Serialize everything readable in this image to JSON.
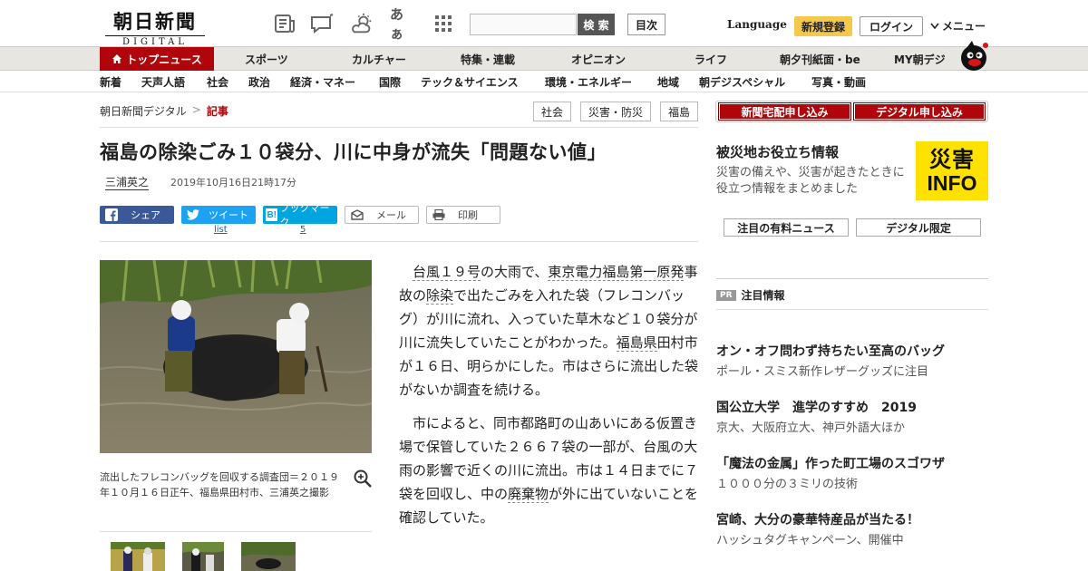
{
  "header": {
    "logo_main": "朝日新聞",
    "logo_sub": "DIGITAL",
    "search_placeholder": "",
    "search_label": "検 索",
    "toc_label": "目次",
    "font_label": "あぁ",
    "language_label": "Language",
    "register_label": "新規登録",
    "login_label": "ログイン",
    "menu_label": "メニュー"
  },
  "nav_primary": {
    "top_news": "トップニュース",
    "items": [
      "スポーツ",
      "カルチャー",
      "特集・連載",
      "オピニオン",
      "ライフ",
      "朝夕刊紙面・be",
      "MY朝デジ"
    ]
  },
  "nav_secondary": {
    "items": [
      "新着",
      "天声人語",
      "社会",
      "政治",
      "経済・マネー",
      "国際",
      "テック＆サイエンス",
      "環境・エネルギー",
      "地域",
      "朝デジスペシャル",
      "写真・動画"
    ]
  },
  "breadcrumb": {
    "home": "朝日新聞デジタル",
    "sep": ">",
    "current": "記事"
  },
  "tags": [
    "社会",
    "災害・防災",
    "福島"
  ],
  "article": {
    "headline": "福島の除染ごみ１０袋分、川に中身が流失「問題ない値」",
    "author": "三浦英之",
    "date": "2019年10月16日21時17分",
    "caption": "流出したフレコンバッグを回収する調査団＝２０１９年１０月１６日正午、福島県田村市、三浦英之撮影",
    "p1": [
      {
        "t": "台風１９号",
        "link": true
      },
      {
        "t": "の大雨で、",
        "link": false
      },
      {
        "t": "東京電力福島第一原発",
        "link": true
      },
      {
        "t": "事故の",
        "link": false
      },
      {
        "t": "除染",
        "link": true
      },
      {
        "t": "で出たごみを入れた袋（フレコンバッグ）が川に流れ、入っていた草木など１０袋分が川に流失していたことがわかった。",
        "link": false
      },
      {
        "t": "福島県",
        "link": true
      },
      {
        "t": "田村市が１６日、明らかにした。市はさらに流出した袋がないか調査を続ける。",
        "link": false
      }
    ],
    "p2": [
      {
        "t": "市によると、同市都路町の山あいにある仮置き場で保管していた２６６７袋の一部が、台風の大雨の影響で近くの川に流出。市は１４日までに７袋を回収し、中の",
        "link": false
      },
      {
        "t": "廃棄物",
        "link": true
      },
      {
        "t": "が外に出ていないことを確認していた。",
        "link": false
      }
    ]
  },
  "share": {
    "facebook": "シェア",
    "twitter": "ツイート",
    "twitter_sub": "list",
    "hatena": "ブックマーク",
    "hatena_sub": "5",
    "mail": "メール",
    "print": "印刷"
  },
  "sidebar": {
    "btn_delivery": "新聞宅配申し込み",
    "btn_digital": "デジタル申し込み",
    "disaster_title": "被災地お役立ち情報",
    "disaster_desc": "災害の備えや、災害が起きたときに役立つ情報をまとめました",
    "disaster_logo_top": "災害",
    "disaster_logo_bottom": "INFO",
    "pill_paid": "注目の有料ニュース",
    "pill_digital": "デジタル限定",
    "pr_badge": "PR",
    "pr_title": "注目情報",
    "ads": [
      {
        "title": "オン・オフ問わず持ちたい至高のバッグ",
        "sub": "ポール・スミス新作レザーグッズに注目"
      },
      {
        "title": "国公立大学　進学のすすめ　2019",
        "sub": "京大、大阪府立大、神戸外語大ほか"
      },
      {
        "title": "「魔法の金属」作った町工場のスゴワザ",
        "sub": "１０００分の３ミリの技術"
      },
      {
        "title": "宮崎、大分の豪華特産品が当たる！",
        "sub": "ハッシュタグキャンペーン、開催中"
      }
    ]
  },
  "colors": {
    "accent_red": "#b0050a",
    "facebook": "#3b5998",
    "twitter": "#1da1f2",
    "hatena": "#00a4de",
    "register": "#f5c84b"
  }
}
